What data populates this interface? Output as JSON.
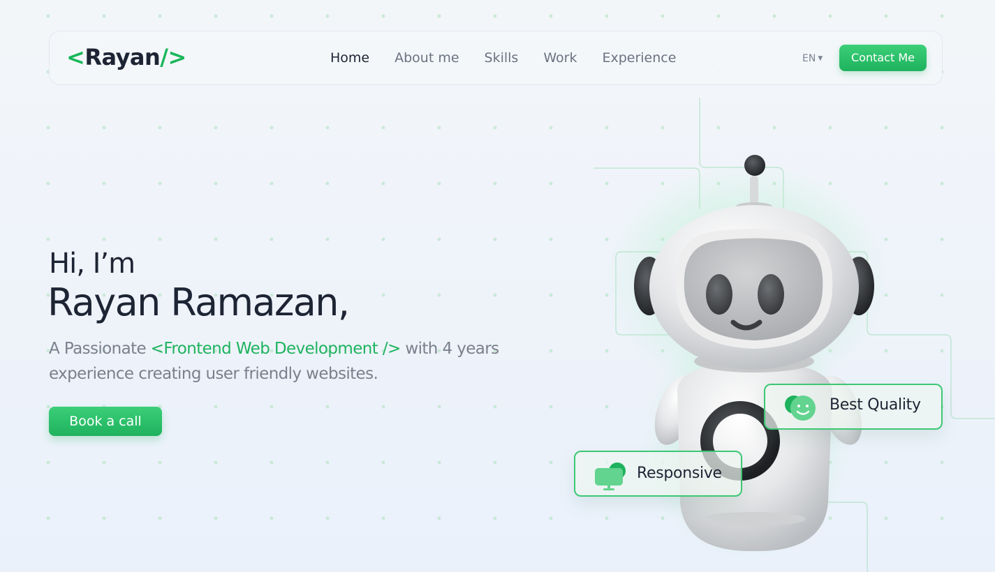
{
  "nav": {
    "logo": {
      "open": "<",
      "name": "Rayan",
      "slash": "/",
      "close": ">"
    },
    "items": [
      {
        "label": "Home",
        "active": true
      },
      {
        "label": "About me",
        "active": false
      },
      {
        "label": "Skills",
        "active": false
      },
      {
        "label": "Work",
        "active": false
      },
      {
        "label": "Experience",
        "active": false
      }
    ],
    "language": "EN",
    "contact_label": "Contact Me"
  },
  "hero": {
    "greeting": "Hi, I’m",
    "name": "Rayan Ramazan,",
    "description_prefix": "A Passionate ",
    "description_highlight": "<Frontend Web Development />",
    "description_suffix": " with 4 years experience creating user friendly websites.",
    "cta_label": "Book a call"
  },
  "badges": {
    "quality": "Best Quality",
    "responsive": "Responsive"
  },
  "icons": {
    "chevron": "chevron-down-icon",
    "quality": "smile-icon",
    "responsive": "monitor-chat-icon",
    "robot": "robot-mascot"
  },
  "colors": {
    "accent": "#1fb25e",
    "text": "#1d2433",
    "muted": "#7a808c"
  }
}
